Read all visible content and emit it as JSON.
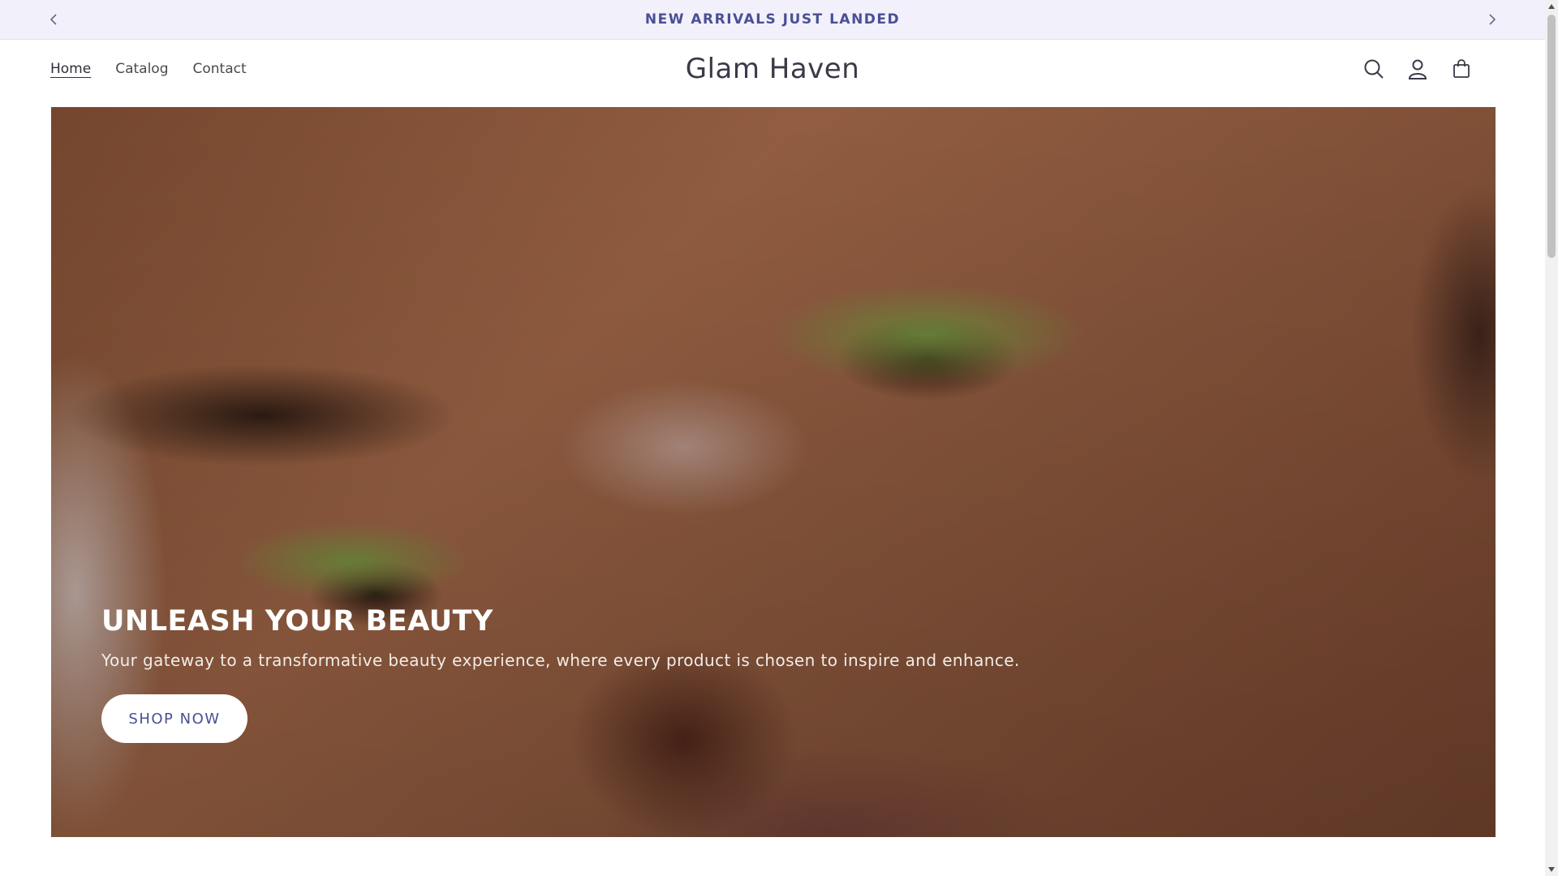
{
  "announcement": {
    "text": "NEW ARRIVALS JUST LANDED",
    "prev_icon": "chevron-left-icon",
    "next_icon": "chevron-right-icon"
  },
  "header": {
    "nav": [
      {
        "label": "Home",
        "active": true
      },
      {
        "label": "Catalog",
        "active": false
      },
      {
        "label": "Contact",
        "active": false
      }
    ],
    "logo": "Glam Haven",
    "icons": [
      "search-icon",
      "account-icon",
      "cart-icon"
    ]
  },
  "hero": {
    "title": "UNLEASH YOUR BEAUTY",
    "subtitle": "Your gateway to a transformative beauty experience, where every product is chosen to inspire and enhance.",
    "button_label": "SHOP NOW"
  },
  "colors": {
    "accent": "#4a4f96",
    "announcement_bg": "#f2f0fa"
  }
}
